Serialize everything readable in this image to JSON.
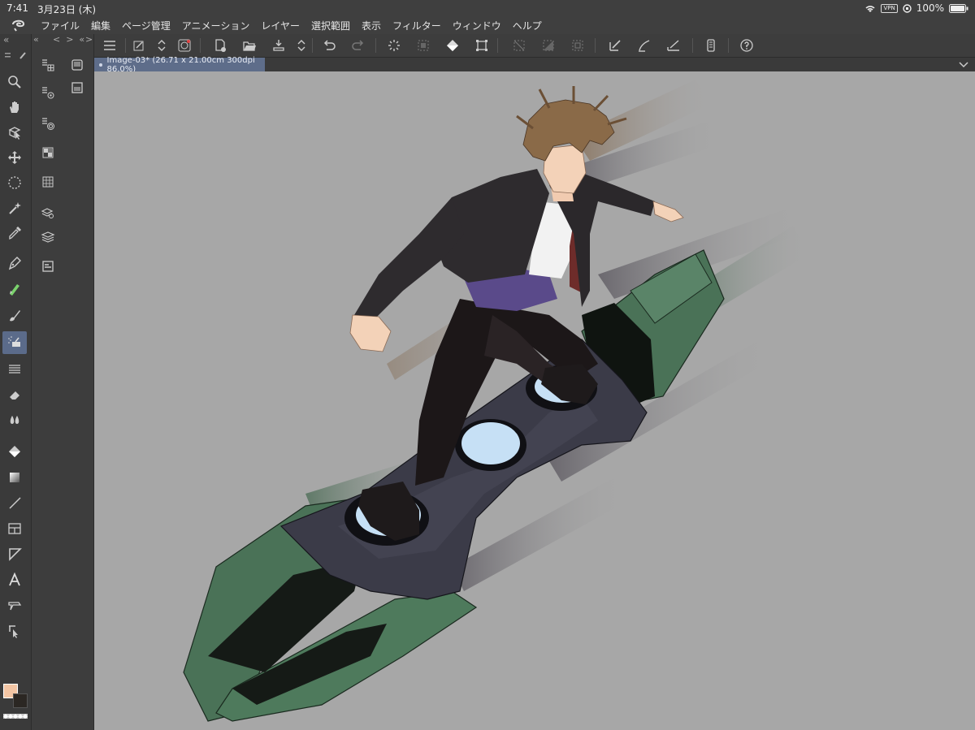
{
  "status": {
    "time": "7:41",
    "date": "3月23日 (木)",
    "vpn": "VPN",
    "battery": "100%"
  },
  "menu": [
    "ファイル",
    "編集",
    "ページ管理",
    "アニメーション",
    "レイヤー",
    "選択範囲",
    "表示",
    "フィルター",
    "ウィンドウ",
    "ヘルプ"
  ],
  "document": {
    "tab_title": "Image-03* (26.71 x 21.00cm 300dpi 86.0%)"
  },
  "subbar": {
    "left_arrows": "«",
    "nav": "<  >  «",
    "right_arrow": ">"
  },
  "colors": {
    "main": "#f3c5a4",
    "sub": "#2b2723",
    "accent": "#5e6d8a",
    "canvas": "#a7a7a7"
  },
  "tools": [
    "zoom-icon",
    "hand-icon",
    "operation-icon",
    "move-icon",
    "selection-icon",
    "magic-wand-icon",
    "eyedropper-icon",
    "pen-icon",
    "pencil-icon",
    "brush-icon",
    "airbrush-icon",
    "decoration-icon",
    "eraser-icon",
    "blend-icon",
    "fill-icon",
    "gradient-icon",
    "figure-icon",
    "frame-icon",
    "ruler-icon",
    "text-icon",
    "balloon-icon",
    "line-correction-icon"
  ]
}
